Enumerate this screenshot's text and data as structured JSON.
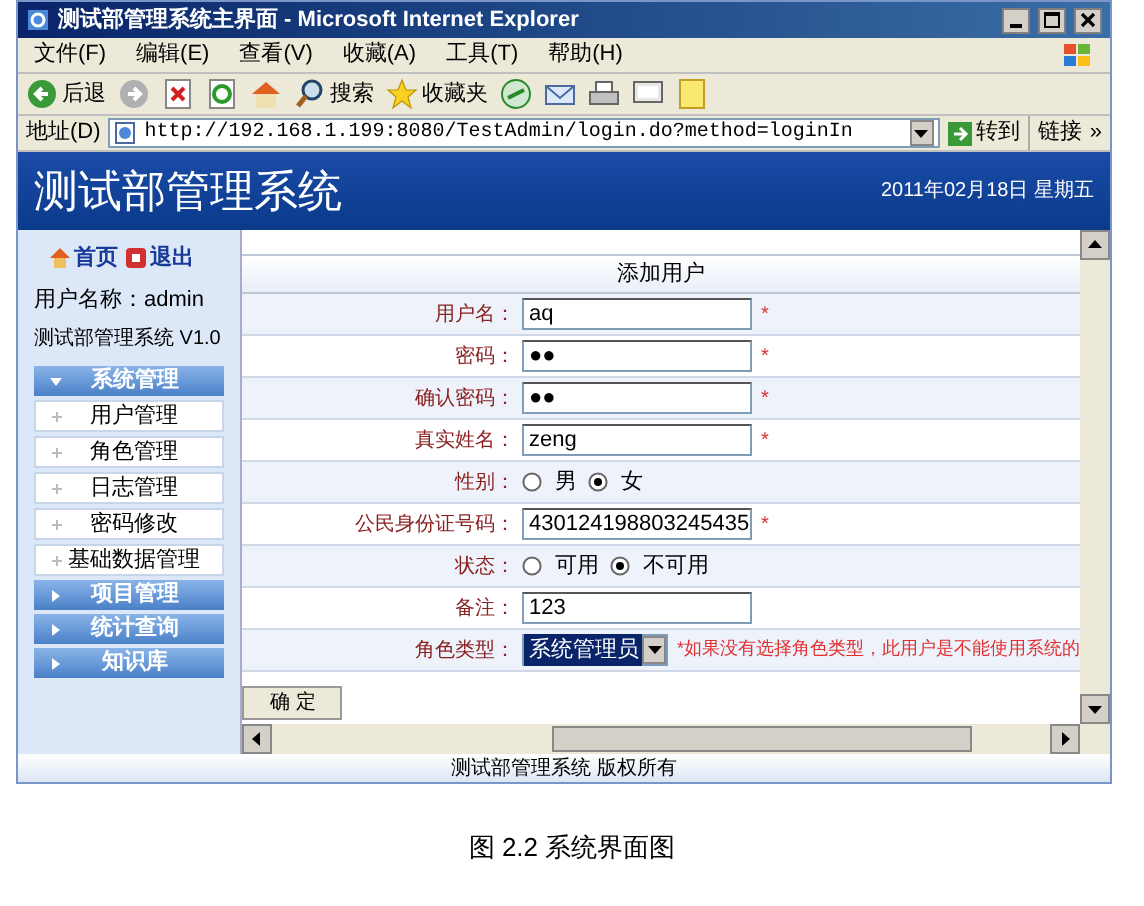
{
  "window": {
    "title": "测试部管理系统主界面 - Microsoft Internet Explorer"
  },
  "menu": [
    "文件(F)",
    "编辑(E)",
    "查看(V)",
    "收藏(A)",
    "工具(T)",
    "帮助(H)"
  ],
  "toolbar": [
    {
      "kind": "back",
      "label": "后退"
    },
    {
      "kind": "forward"
    },
    {
      "kind": "stop"
    },
    {
      "kind": "refresh"
    },
    {
      "kind": "home"
    },
    {
      "kind": "search",
      "label": "搜索"
    },
    {
      "kind": "favorites",
      "label": "收藏夹"
    },
    {
      "kind": "media"
    },
    {
      "kind": "mail"
    },
    {
      "kind": "print"
    },
    {
      "kind": "edit"
    },
    {
      "kind": "note"
    }
  ],
  "address_bar": {
    "label": "地址(D)",
    "url": "http://192.168.1.199:8080/TestAdmin/login.do?method=loginIn",
    "go": "转到",
    "links": "链接",
    "more": "»"
  },
  "banner": {
    "title": "测试部管理系统",
    "date": "2011年02月18日 星期五"
  },
  "sidebar": {
    "links": [
      {
        "kind": "home",
        "label": "首页"
      },
      {
        "kind": "exit",
        "label": "退出"
      }
    ],
    "username": "用户名称：admin",
    "version": "测试部管理系统 V1.0",
    "groups": [
      {
        "label": "系统管理",
        "expanded": true,
        "children": [
          "用户管理",
          "角色管理",
          "日志管理",
          "密码修改",
          "基础数据管理"
        ]
      },
      {
        "label": "项目管理",
        "expanded": false
      },
      {
        "label": "统计查询",
        "expanded": false
      },
      {
        "label": "知识库",
        "expanded": false
      }
    ]
  },
  "form": {
    "title": "添加用户",
    "fields": [
      {
        "kind": "text",
        "label": "用户名：",
        "value": "aq",
        "mark": "*"
      },
      {
        "kind": "text",
        "label": "密码：",
        "value": "●●",
        "mark": "*"
      },
      {
        "kind": "text",
        "label": "确认密码：",
        "value": "●●",
        "mark": "*"
      },
      {
        "kind": "text",
        "label": "真实姓名：",
        "value": "zeng",
        "mark": "*"
      },
      {
        "kind": "radio",
        "label": "性别：",
        "options": [
          {
            "label": "男",
            "selected": false
          },
          {
            "label": "女",
            "selected": true
          }
        ]
      },
      {
        "kind": "text",
        "label": "公民身份证号码：",
        "value": "430124198803245435",
        "mark": "*"
      },
      {
        "kind": "radio",
        "label": "状态：",
        "options": [
          {
            "label": "可用",
            "selected": false
          },
          {
            "label": "不可用",
            "selected": true
          }
        ]
      },
      {
        "kind": "text",
        "label": "备注：",
        "value": "123"
      },
      {
        "kind": "select",
        "label": "角色类型：",
        "value": "系统管理员",
        "note": "*如果没有选择角色类型，此用户是不能使用系统的"
      }
    ],
    "submit": "确 定"
  },
  "footer": "测试部管理系统 版权所有",
  "caption": "图 2.2 系统界面图"
}
